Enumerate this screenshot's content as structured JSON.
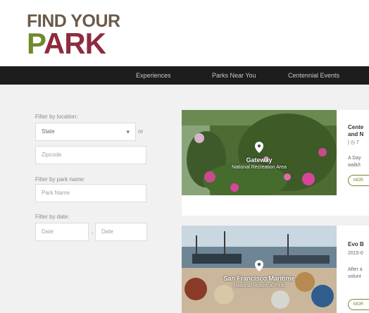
{
  "logo": {
    "line1": "FIND YOUR",
    "line2_first": "P",
    "line2_rest": "ARK"
  },
  "nav": {
    "items": [
      "Experiences",
      "Parks Near You",
      "Centennial Events"
    ]
  },
  "filters": {
    "location_label": "Filter by location:",
    "state_value": "State",
    "or_text": "or",
    "zipcode_placeholder": "Zipcode",
    "park_name_label": "Filter by park name:",
    "park_name_placeholder": "Park Name",
    "date_label": "Filter by date:",
    "date_from_placeholder": "Date",
    "date_dash": "-",
    "date_to_placeholder": "Date"
  },
  "cards": [
    {
      "park_name": "Gateway",
      "park_type": "National Recreation Area",
      "title_line1": "Cente",
      "title_line2": "and N",
      "meta": "| ◷ 7",
      "desc_line1": "A Day",
      "desc_line2": "walk/t",
      "more_label": "MOR"
    },
    {
      "park_name": "San Francisco Maritime",
      "park_type": "National Historical Park",
      "title_line1": "Evo B",
      "meta": "2015-0",
      "desc_line1": "After a",
      "desc_line2": "volunt",
      "more_label": "MOR"
    }
  ],
  "colors": {
    "brand_green": "#6f8a2c",
    "brand_maroon": "#8e2b3f",
    "nav_bg": "#1d1d1d"
  }
}
